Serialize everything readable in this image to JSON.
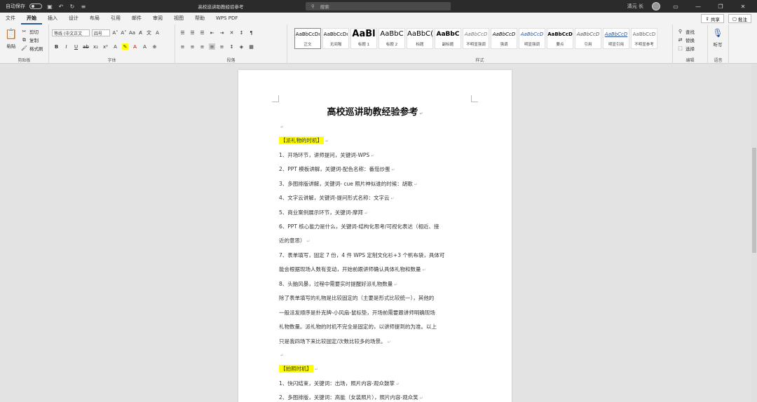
{
  "titlebar": {
    "autosave_label": "自动保存",
    "autosave_state": "off",
    "doc_title": "高校巡讲助教经验参考",
    "search_placeholder": "搜索",
    "user_name": "清元 长"
  },
  "menu": {
    "tabs": [
      "文件",
      "开始",
      "插入",
      "设计",
      "布局",
      "引用",
      "邮件",
      "审阅",
      "视图",
      "帮助",
      "WPS PDF"
    ],
    "active": "开始",
    "share_label": "共享",
    "comment_label": "批注"
  },
  "ribbon": {
    "clipboard": {
      "label": "剪贴板",
      "paste": "粘贴",
      "cut": "剪切",
      "copy": "复制",
      "format_painter": "格式刷"
    },
    "font": {
      "label": "字体",
      "font_name": "等线 (中文正文",
      "font_size": "四号"
    },
    "paragraph": {
      "label": "段落"
    },
    "styles": {
      "label": "样式",
      "items": [
        {
          "sample": "AaBbCcDı",
          "name": "正文"
        },
        {
          "sample": "AaBbCcDı",
          "name": "无间隔"
        },
        {
          "sample": "AaBl",
          "name": "标题 1"
        },
        {
          "sample": "AaBbC",
          "name": "标题 2"
        },
        {
          "sample": "AaBbC(",
          "name": "标题"
        },
        {
          "sample": "AaBbC",
          "name": "副标题"
        },
        {
          "sample": "AaBbCcD",
          "name": "不明显强调"
        },
        {
          "sample": "AaBbCcD",
          "name": "强调"
        },
        {
          "sample": "AaBbCcD",
          "name": "明显强调"
        },
        {
          "sample": "AaBbCcD",
          "name": "要点"
        },
        {
          "sample": "AaBbCcD",
          "name": "引用"
        },
        {
          "sample": "AaBbCcD",
          "name": "明显引用"
        },
        {
          "sample": "AaBbCcD",
          "name": "不明显参考"
        }
      ]
    },
    "editing": {
      "label": "编辑",
      "find": "查找",
      "replace": "替换",
      "select": "选择"
    },
    "voice": {
      "label": "语音",
      "dictate": "听写"
    }
  },
  "document": {
    "title": "高校巡讲助教经验参考",
    "paragraphs": [
      {
        "text": "【派礼物的时机】",
        "highlight": true
      },
      {
        "text": "1、开场环节，讲师提问，关键词-WPS"
      },
      {
        "text": "2、PPT 模板讲解，关键词-配色名称：番茄炒蛋"
      },
      {
        "text": "3、多图排版讲解，关键词- cue 照片神似谁的时候：胡歌"
      },
      {
        "text": "4、文字云讲解，关键词-提问形式名称：文字云"
      },
      {
        "text": "5、商业案例展示环节，关键词-摩拜"
      },
      {
        "text": "6、PPT 核心能力是什么，关键词-结构化思考/可视化表达（相近、接"
      },
      {
        "text": "近的意思）"
      },
      {
        "text": "7、表单填写，固定 7 份，4 件 WPS 定制文化衫+3 个帆布袋，具体可"
      },
      {
        "text": "能会根据现场人数有变动，开始前跟讲师确认具体礼物和数量"
      },
      {
        "text": "8、头脑风暴，过程中需要实时提醒好派礼物数量"
      },
      {
        "text": "除了表单填写的礼物是比较固定的（主要是形式比较统一），其他的"
      },
      {
        "text": "一般派发顺序是扑克牌-小风扇-鼠标垫，开场前需要跟讲师明确现场"
      },
      {
        "text": "礼物数量。派礼物的时机不完全是固定的，以讲师提到的为准。以上"
      },
      {
        "text": "只是我四场下来比较固定/次数比较多的场景。"
      },
      {
        "text": ""
      },
      {
        "text": "【拍照时机】",
        "highlight": true
      },
      {
        "text": "1、快闪结束，关键词：出场，照片内容-观众鼓掌"
      },
      {
        "text": "2、多图排版，关键词：高能（女装照片），照片内容-观众笑"
      }
    ]
  }
}
